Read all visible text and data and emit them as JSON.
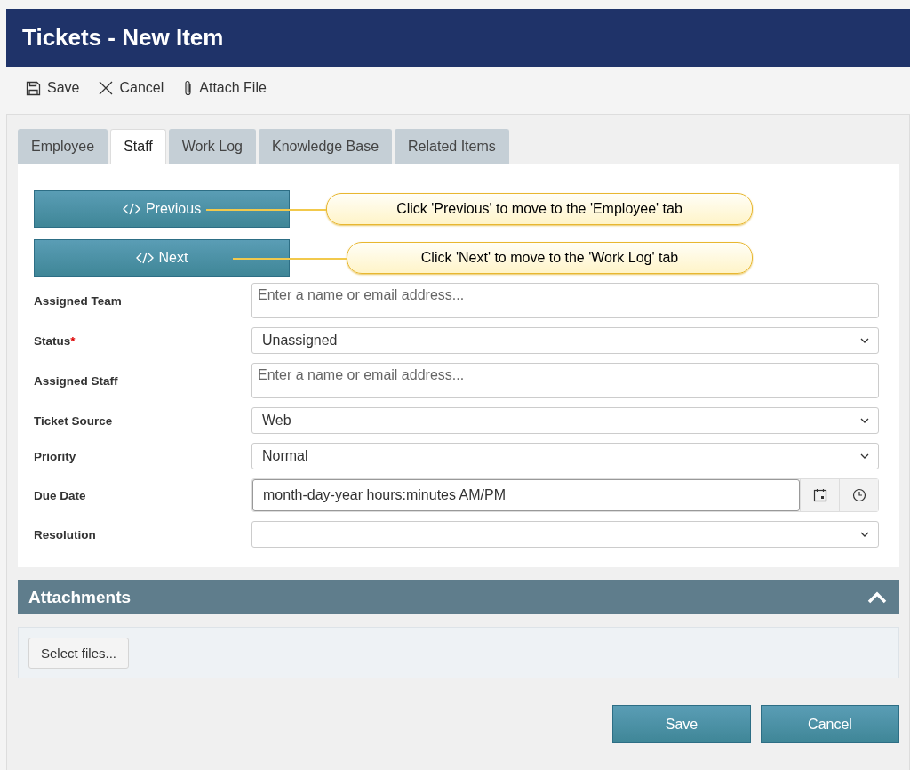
{
  "window": {
    "title": "Tickets - New Item"
  },
  "toolbar": [
    {
      "kind": "save",
      "label": "Save"
    },
    {
      "kind": "cancel",
      "label": "Cancel"
    },
    {
      "kind": "attach",
      "label": "Attach File"
    }
  ],
  "tabs": [
    {
      "label": "Employee",
      "selected": false
    },
    {
      "label": "Staff",
      "selected": true
    },
    {
      "label": "Work Log",
      "selected": false
    },
    {
      "label": "Knowledge Base",
      "selected": false
    },
    {
      "label": "Related Items",
      "selected": false
    }
  ],
  "nav_buttons": [
    {
      "label": "Previous",
      "callout": "Click 'Previous' to move to the 'Employee' tab"
    },
    {
      "label": "Next",
      "callout": "Click 'Next' to move to the 'Work Log' tab"
    }
  ],
  "fields": [
    {
      "label": "Assigned Team",
      "kind": "people",
      "placeholder": "Enter a name or email address..."
    },
    {
      "label": "Status",
      "required_mark": "*",
      "kind": "select",
      "value": "Unassigned"
    },
    {
      "label": "Assigned Staff",
      "kind": "people",
      "placeholder": "Enter a name or email address..."
    },
    {
      "label": "Ticket Source",
      "kind": "select",
      "value": "Web"
    },
    {
      "label": "Priority",
      "kind": "select",
      "value": "Normal"
    },
    {
      "label": "Due Date",
      "kind": "datetime",
      "value": "month-day-year hours:minutes AM/PM"
    },
    {
      "label": "Resolution",
      "kind": "select"
    }
  ],
  "attachments": {
    "title": "Attachments",
    "expanded": true,
    "button": "Select files..."
  },
  "footer_buttons": [
    "Save",
    "Cancel"
  ]
}
